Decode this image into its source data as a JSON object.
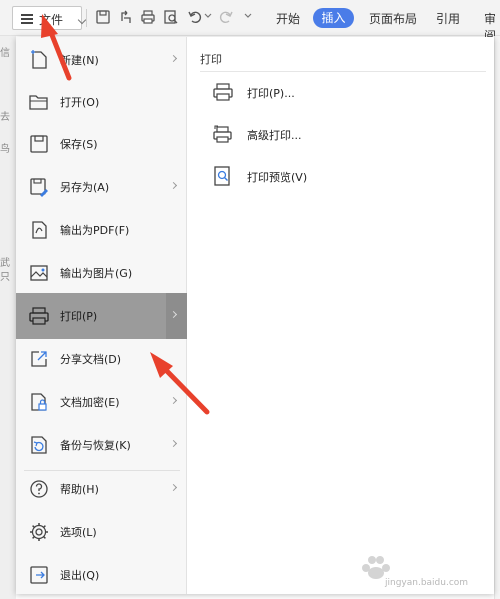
{
  "toolbar": {
    "file_label": "文件",
    "tabs": [
      "开始",
      "插入",
      "页面布局",
      "引用",
      "审阅"
    ],
    "active_tab": "插入",
    "accent_color": "#4a7ce8"
  },
  "menu": {
    "items": [
      {
        "label": "新建(N)",
        "icon": "new-file-icon",
        "submenu": true
      },
      {
        "label": "打开(O)",
        "icon": "folder-open-icon",
        "submenu": false
      },
      {
        "label": "保存(S)",
        "icon": "save-icon",
        "submenu": false
      },
      {
        "label": "另存为(A)",
        "icon": "save-as-icon",
        "submenu": true
      },
      {
        "label": "输出为PDF(F)",
        "icon": "export-pdf-icon",
        "submenu": false
      },
      {
        "label": "输出为图片(G)",
        "icon": "export-image-icon",
        "submenu": false
      },
      {
        "label": "打印(P)",
        "icon": "printer-icon",
        "submenu": true,
        "active": true
      },
      {
        "label": "分享文档(D)",
        "icon": "share-icon",
        "submenu": false
      },
      {
        "label": "文档加密(E)",
        "icon": "encrypt-icon",
        "submenu": true
      },
      {
        "label": "备份与恢复(K)",
        "icon": "backup-icon",
        "submenu": true
      },
      {
        "label": "帮助(H)",
        "icon": "help-icon",
        "submenu": true
      },
      {
        "label": "选项(L)",
        "icon": "settings-gear-icon",
        "submenu": false
      },
      {
        "label": "退出(Q)",
        "icon": "exit-icon",
        "submenu": false
      }
    ]
  },
  "submenu": {
    "title": "打印",
    "items": [
      {
        "label": "打印(P)...",
        "icon": "printer-icon"
      },
      {
        "label": "高级打印...",
        "icon": "advanced-print-icon"
      },
      {
        "label": "打印预览(V)",
        "icon": "print-preview-icon"
      }
    ]
  },
  "background_fragments": [
    "信",
    "去",
    "鸟",
    "武",
    "只"
  ],
  "watermark": {
    "text": "jingyan.baidu.com"
  },
  "annotation_color": "#e8412c"
}
